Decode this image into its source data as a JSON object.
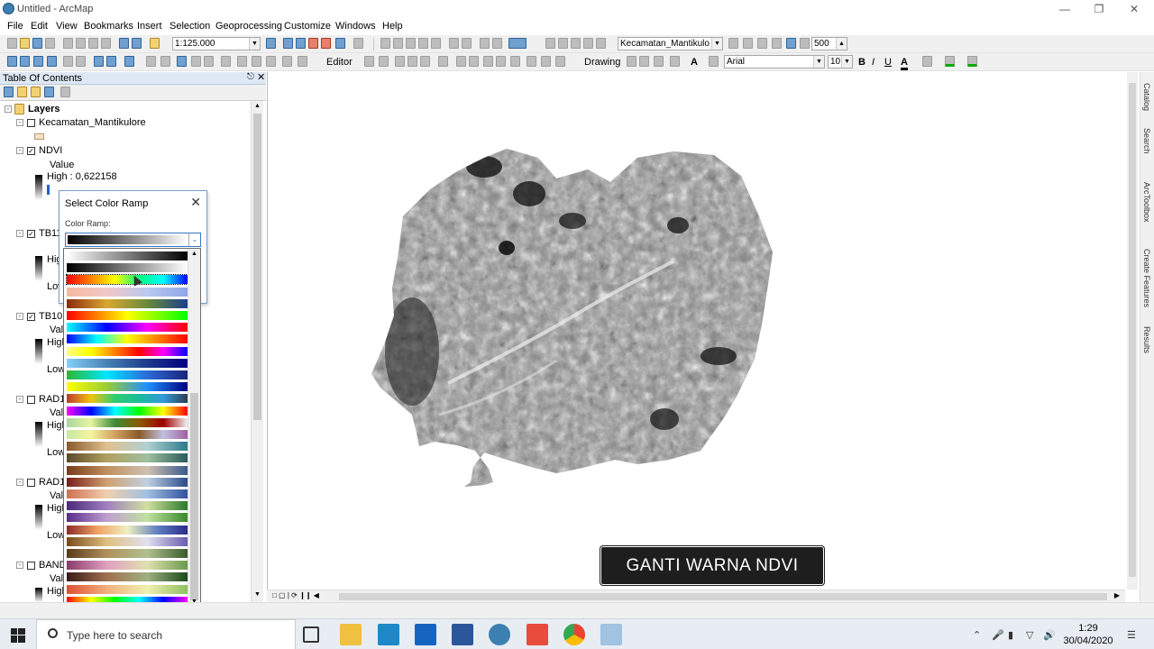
{
  "window": {
    "title": "Untitled - ArcMap"
  },
  "menu": [
    "File",
    "Edit",
    "View",
    "Bookmarks",
    "Insert",
    "Selection",
    "Geoprocessing",
    "Customize",
    "Windows",
    "Help"
  ],
  "toolbar": {
    "scale": "1:125.000",
    "layer_combo": "Kecamatan_Mantikulo",
    "number_box": "500",
    "editor_label": "Editor",
    "drawing_label": "Drawing",
    "font": "Arial",
    "font_size": "10",
    "bold": "B",
    "italic": "I",
    "underline": "U",
    "text_tool": "A"
  },
  "toc": {
    "title": "Table Of Contents",
    "root": "Layers",
    "layers": [
      {
        "name": "Kecamatan_Mantikulore",
        "checked": false
      },
      {
        "name": "NDVI",
        "checked": true,
        "value_label": "Value",
        "high": "High : 0,622158",
        "low": "Low"
      },
      {
        "name": "TB11",
        "checked": true,
        "high": "High",
        "low": "Low"
      },
      {
        "name": "TB10",
        "checked": true,
        "value_label": "Value",
        "high": "High",
        "low": "Low"
      },
      {
        "name": "RAD11",
        "checked": false,
        "value_label": "Value",
        "high": "High",
        "low": "Low"
      },
      {
        "name": "RAD10",
        "checked": false,
        "value_label": "Value",
        "high": "High",
        "low": "Low"
      },
      {
        "name": "BAND",
        "checked": false,
        "value_label": "Value",
        "high": "High"
      }
    ]
  },
  "dialog": {
    "title": "Select Color Ramp",
    "label": "Color Ramp:"
  },
  "ramps": [
    [
      "#ffffff",
      "#000000"
    ],
    [
      "#000000",
      "#ffffff"
    ],
    [
      "#ff0000",
      "#ff8000",
      "#ffff00",
      "#00ff80",
      "#00ffff",
      "#0000ff"
    ],
    [
      "#f4b9a1",
      "#f2c7c7",
      "#b9c9ef",
      "#8fa5e8"
    ],
    [
      "#8b2a0f",
      "#d9a830",
      "#6a8a3a",
      "#1a3f8a"
    ],
    [
      "#ff0000",
      "#ffff00",
      "#00ff00"
    ],
    [
      "#00ffff",
      "#0000ff",
      "#ff00ff",
      "#ff0000"
    ],
    [
      "#0000ff",
      "#00ffff",
      "#ffff00",
      "#ff8000",
      "#ff0000"
    ],
    [
      "#ffff80",
      "#ffff00",
      "#ff8000",
      "#ff0000",
      "#ff00ff",
      "#0000ff"
    ],
    [
      "#87cefa",
      "#4682b4",
      "#1e3a8a",
      "#000080"
    ],
    [
      "#2eb82e",
      "#00e5ff",
      "#2a6bd8",
      "#1a237e"
    ],
    [
      "#ffff00",
      "#9acd32",
      "#1e90ff",
      "#000080"
    ],
    [
      "#c0392b",
      "#f1c40f",
      "#2ecc71",
      "#1abc9c",
      "#3498db",
      "#2c3e50"
    ],
    [
      "#ff00ff",
      "#0000ff",
      "#00ffff",
      "#00ff00",
      "#ffff00",
      "#ff0000"
    ],
    [
      "#a9d4a0",
      "#e8f4a0",
      "#3a8a3a",
      "#8b5a00",
      "#a00000",
      "#f0f0f0"
    ],
    [
      "#c4e8a0",
      "#f4f4a0",
      "#d4a060",
      "#8a5a2a",
      "#c0c0e0",
      "#a060a0"
    ],
    [
      "#8a5a2a",
      "#e0c090",
      "#b0d0d0",
      "#2a7a8a"
    ],
    [
      "#5a4a2a",
      "#b0a060",
      "#a0c0a0",
      "#2a5a5a"
    ],
    [
      "#7a3a1a",
      "#c09060",
      "#d0c0b0",
      "#3a5a8a"
    ],
    [
      "#7a1a1a",
      "#d0a070",
      "#c0d0e0",
      "#2a4a8a"
    ],
    [
      "#d07050",
      "#f0d0b0",
      "#a0c0e0",
      "#3050a0"
    ],
    [
      "#4a2a7a",
      "#a080c0",
      "#d0e0a0",
      "#2a7a2a"
    ],
    [
      "#5a2a8a",
      "#c0a0d0",
      "#c0e0a0",
      "#3a8a2a"
    ],
    [
      "#8a2a2a",
      "#f0a060",
      "#f0f0c0",
      "#6080c0",
      "#2a2a8a"
    ],
    [
      "#7a4a1a",
      "#e0c080",
      "#e0e0f0",
      "#6a5ab0"
    ],
    [
      "#5a3a1a",
      "#b0905a",
      "#b0c090",
      "#3a5a2a"
    ],
    [
      "#8a3a6a",
      "#e0a0c0",
      "#e0e0b0",
      "#6a9a4a"
    ],
    [
      "#3a1a1a",
      "#a07050",
      "#a0b080",
      "#1a4a1a"
    ],
    [
      "#e05030",
      "#f0b080",
      "#f0f0b0",
      "#90c060"
    ],
    [
      "#ff0000",
      "#ffff00",
      "#00ff00",
      "#00ffff",
      "#0000ff",
      "#ff00ff"
    ],
    [
      "#a0c0e0",
      "#f0e0a0",
      "#e07060",
      "#c02020"
    ]
  ],
  "caption": "GANTI WARNA NDVI",
  "dock_tabs": [
    "Catalog",
    "Search",
    "ArcToolbox",
    "Create Features",
    "Results"
  ],
  "taskbar": {
    "search_placeholder": "Type here to search",
    "time": "1:29",
    "date": "30/04/2020"
  }
}
